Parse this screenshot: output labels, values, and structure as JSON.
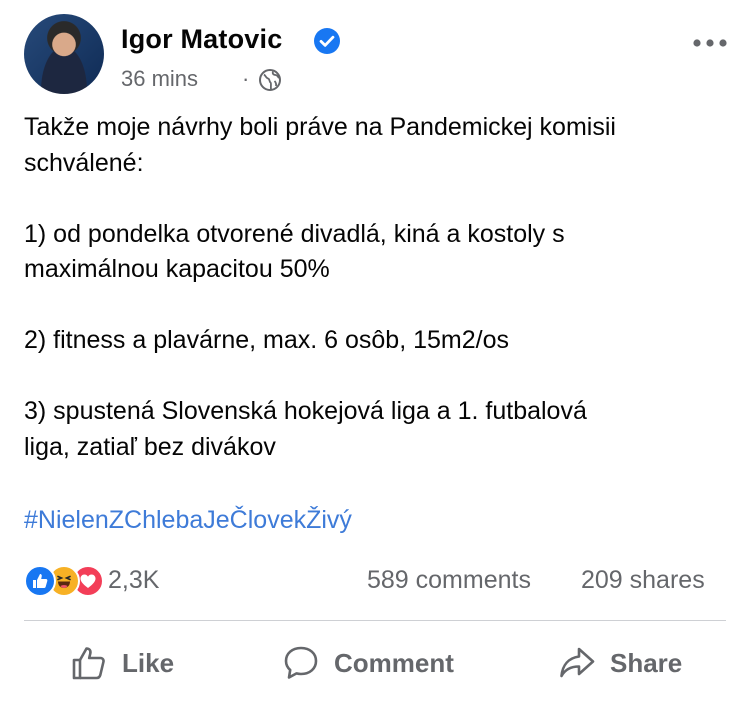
{
  "post": {
    "author": "Igor Matovic",
    "time": "36 mins",
    "separator": "·",
    "body": "Takže moje návrhy boli práve na Pandemickej komisii\nschválené:\n\n1) od pondelka otvorené divadlá, kiná a kostoly s\nmaximálnou kapacitou 50%\n\n2) fitness a plavárne, max. 6 osôb, 15m2/os\n\n3) spustená Slovenská hokejová liga a 1. futbalová\nliga, zatiaľ bez divákov",
    "hashtag": "#NielenZChlebaJeČlovekŽivý"
  },
  "icons": {
    "verified": "verified-badge-icon",
    "privacy": "globe-icon",
    "more": "more-options-icon",
    "reactions": [
      "like-reaction-icon",
      "haha-reaction-icon",
      "love-reaction-icon"
    ]
  },
  "stats": {
    "reactions": "2,3K",
    "comments": "589 comments",
    "shares": "209 shares"
  },
  "actions": {
    "like": "Like",
    "comment": "Comment",
    "share": "Share"
  },
  "colors": {
    "text": "#050505",
    "secondary": "#65676b",
    "link": "#3e7bd8",
    "like_blue": "#1877f2",
    "haha_yellow": "#f7b125",
    "love_red": "#f33e58"
  }
}
